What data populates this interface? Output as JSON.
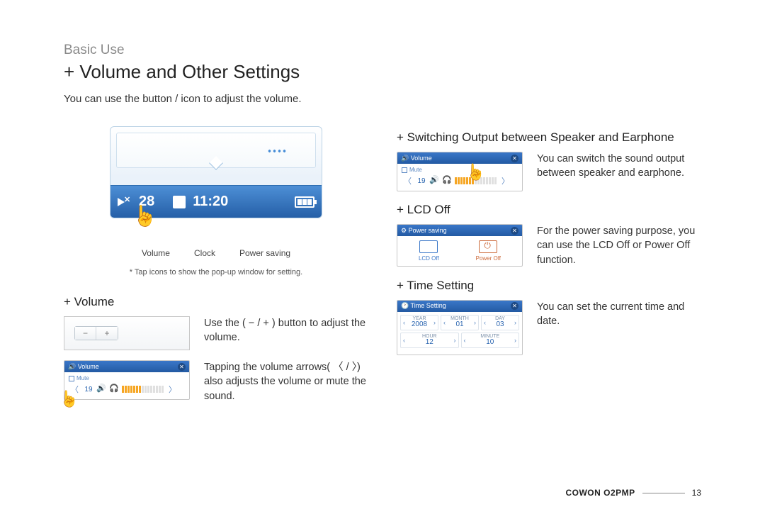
{
  "breadcrumb": "Basic Use",
  "title": "Volume and Other Settings",
  "intro": "You can use the button / icon to adjust the volume.",
  "mainMock": {
    "volValue": "28",
    "time": "11:20",
    "labels": {
      "volume": "Volume",
      "clock": "Clock",
      "power": "Power saving"
    },
    "tapNote": "* Tap icons to show the pop-up window for setting."
  },
  "volume": {
    "heading": "Volume",
    "hwText": "Use the ( − / + ) button to adjust the volume.",
    "popupText": "Tapping the volume arrows( 〈 / 〉) also adjusts the volume or mute the sound.",
    "popup": {
      "title": "Volume",
      "mute": "Mute",
      "level": "19"
    }
  },
  "output": {
    "heading": "Switching Output between Speaker and Earphone",
    "text": "You can switch the sound output between speaker and earphone.",
    "popup": {
      "title": "Volume",
      "mute": "Mute",
      "level": "19"
    }
  },
  "lcd": {
    "heading": "LCD Off",
    "text": "For the power saving purpose, you can use the LCD Off or Power Off function.",
    "popup": {
      "title": "Power saving",
      "opt1": "LCD Off",
      "opt2": "Power Off"
    }
  },
  "time": {
    "heading": "Time Setting",
    "text": "You can set the current time and date.",
    "popup": {
      "title": "Time Setting",
      "year": {
        "label": "YEAR",
        "value": "2008"
      },
      "month": {
        "label": "MONTH",
        "value": "01"
      },
      "day": {
        "label": "DAY",
        "value": "03"
      },
      "hour": {
        "label": "HOUR",
        "value": "12"
      },
      "minute": {
        "label": "MINUTE",
        "value": "10"
      }
    }
  },
  "footer": {
    "brand": "COWON O2PMP",
    "page": "13"
  }
}
